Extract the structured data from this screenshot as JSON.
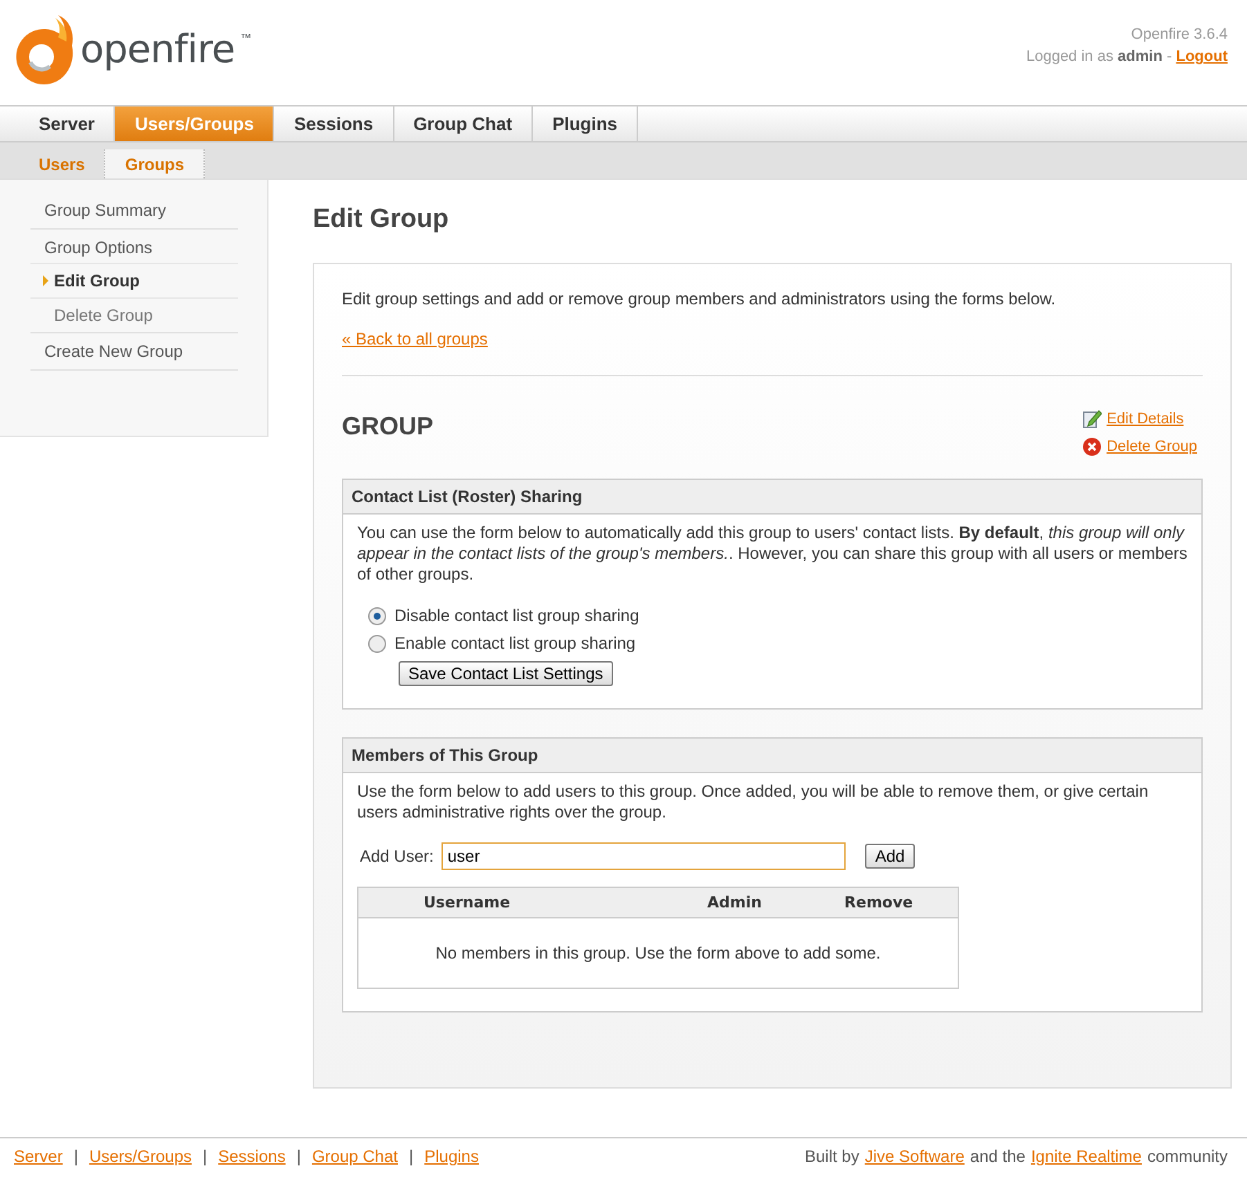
{
  "header": {
    "product": "openfire",
    "trademark": "™",
    "version": "Openfire 3.6.4",
    "login_prefix": "Logged in as",
    "user": "admin",
    "separator": "-",
    "logout": "Logout"
  },
  "tabs": [
    {
      "label": "Server",
      "selected": false
    },
    {
      "label": "Users/Groups",
      "selected": true
    },
    {
      "label": "Sessions",
      "selected": false
    },
    {
      "label": "Group Chat",
      "selected": false
    },
    {
      "label": "Plugins",
      "selected": false
    }
  ],
  "subtabs": [
    {
      "label": "Users",
      "selected": false
    },
    {
      "label": "Groups",
      "selected": true
    }
  ],
  "sidebar": {
    "items": [
      {
        "label": "Group Summary"
      },
      {
        "label": "Group Options",
        "children": [
          {
            "label": "Edit Group",
            "selected": true
          },
          {
            "label": "Delete Group",
            "selected": false
          }
        ]
      },
      {
        "label": "Create New Group"
      }
    ]
  },
  "page": {
    "title": "Edit Group",
    "intro": "Edit group settings and add or remove group members and administrators using the forms below.",
    "back_link": "« Back to all groups",
    "group_name": "GROUP",
    "actions": [
      {
        "kind": "edit",
        "label": "Edit Details"
      },
      {
        "kind": "delete",
        "label": "Delete Group"
      }
    ]
  },
  "sharing": {
    "title": "Contact List (Roster) Sharing",
    "description": "You can use the form below to automatically add this group to users' contact lists. **By default**, *this group will only appear in the contact lists of the group's members.*. However, you can share this group with all users or members of other groups.",
    "options": [
      {
        "label": "Disable contact list group sharing",
        "selected": true
      },
      {
        "label": "Enable contact list group sharing",
        "selected": false
      }
    ],
    "save_button": "Save Contact List Settings"
  },
  "members": {
    "title": "Members of This Group",
    "description": "Use the form below to add users to this group. Once added, you will be able to remove them, or give certain users administrative rights over the group.",
    "add_label": "Add User:",
    "add_value": "user",
    "add_button": "Add",
    "table": {
      "columns": [
        "Username",
        "Admin",
        "Remove"
      ],
      "empty_message": "No members in this group. Use the form above to add some."
    }
  },
  "footer": {
    "items": [
      {
        "kind": "link",
        "text": "Server"
      },
      {
        "kind": "sep",
        "text": "|"
      },
      {
        "kind": "link",
        "text": "Users/Groups"
      },
      {
        "kind": "sep",
        "text": "|"
      },
      {
        "kind": "link",
        "text": "Sessions"
      },
      {
        "kind": "sep",
        "text": "|"
      },
      {
        "kind": "link",
        "text": "Group Chat"
      },
      {
        "kind": "sep",
        "text": "|"
      },
      {
        "kind": "link",
        "text": "Plugins"
      }
    ],
    "credit": [
      {
        "kind": "text",
        "text": "Built by"
      },
      {
        "kind": "link",
        "text": "Jive Software"
      },
      {
        "kind": "text",
        "text": "and the"
      },
      {
        "kind": "link",
        "text": "Ignite Realtime"
      },
      {
        "kind": "text",
        "text": "community"
      }
    ]
  }
}
